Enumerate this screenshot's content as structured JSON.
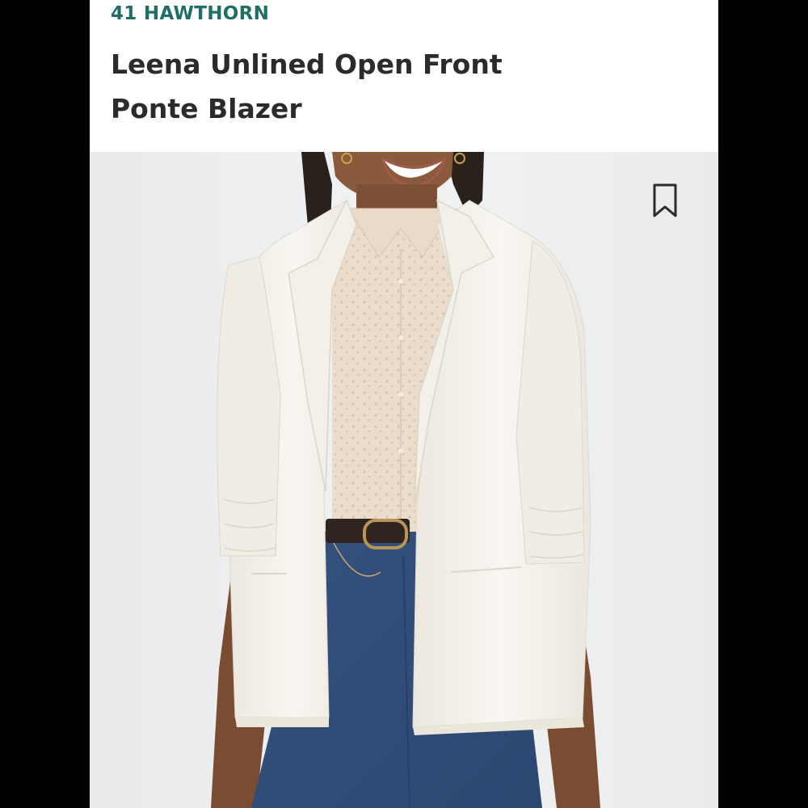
{
  "product": {
    "brand": "41 HAWTHORN",
    "title": "Leena Unlined Open Front Ponte Blazer"
  },
  "image": {
    "alt": "Model wearing white open front ponte blazer over a printed button-up shirt with belted jeans"
  },
  "actions": {
    "bookmark_icon": "bookmark-outline-icon"
  },
  "colors": {
    "brand": "#1f6f66",
    "title": "#2b2b2b",
    "photo_bg": "#eceef0",
    "blazer": "#f6f3ec",
    "shirt": "#ecdccc",
    "denim": "#3a5a8a"
  }
}
